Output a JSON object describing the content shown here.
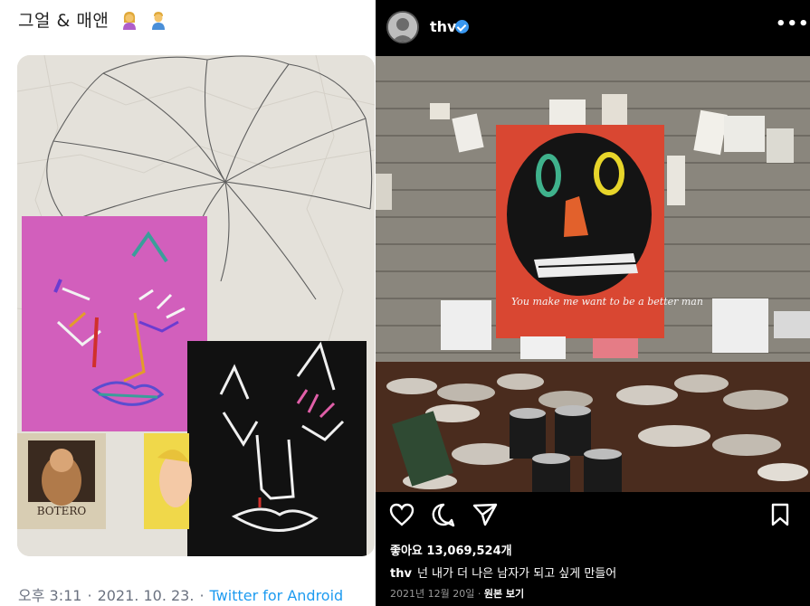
{
  "twitter": {
    "tweet_text": "그얼 & 매앤",
    "emoji_1": "woman-emoji",
    "emoji_2": "man-emoji",
    "time": "오후 3:11",
    "date": "2021. 10. 23.",
    "separator": "·",
    "source": "Twitter for Android",
    "photo_book_label": "BOTERO",
    "link_color": "#1d9bf0"
  },
  "instagram": {
    "username": "thv",
    "verified": true,
    "more_icon": "more-dots-icon",
    "painting_text": "You make me want to be a better man",
    "actions": [
      "heart-icon",
      "comment-icon",
      "share-icon",
      "bookmark-icon"
    ],
    "likes": "좋아요 13,069,524개",
    "caption_user": "thv",
    "caption_text": "넌 내가 더 나은 남자가 되고 싶게 만들어",
    "date": "2021년 12월 20일",
    "separator": "·",
    "original_link": "원본 보기"
  }
}
